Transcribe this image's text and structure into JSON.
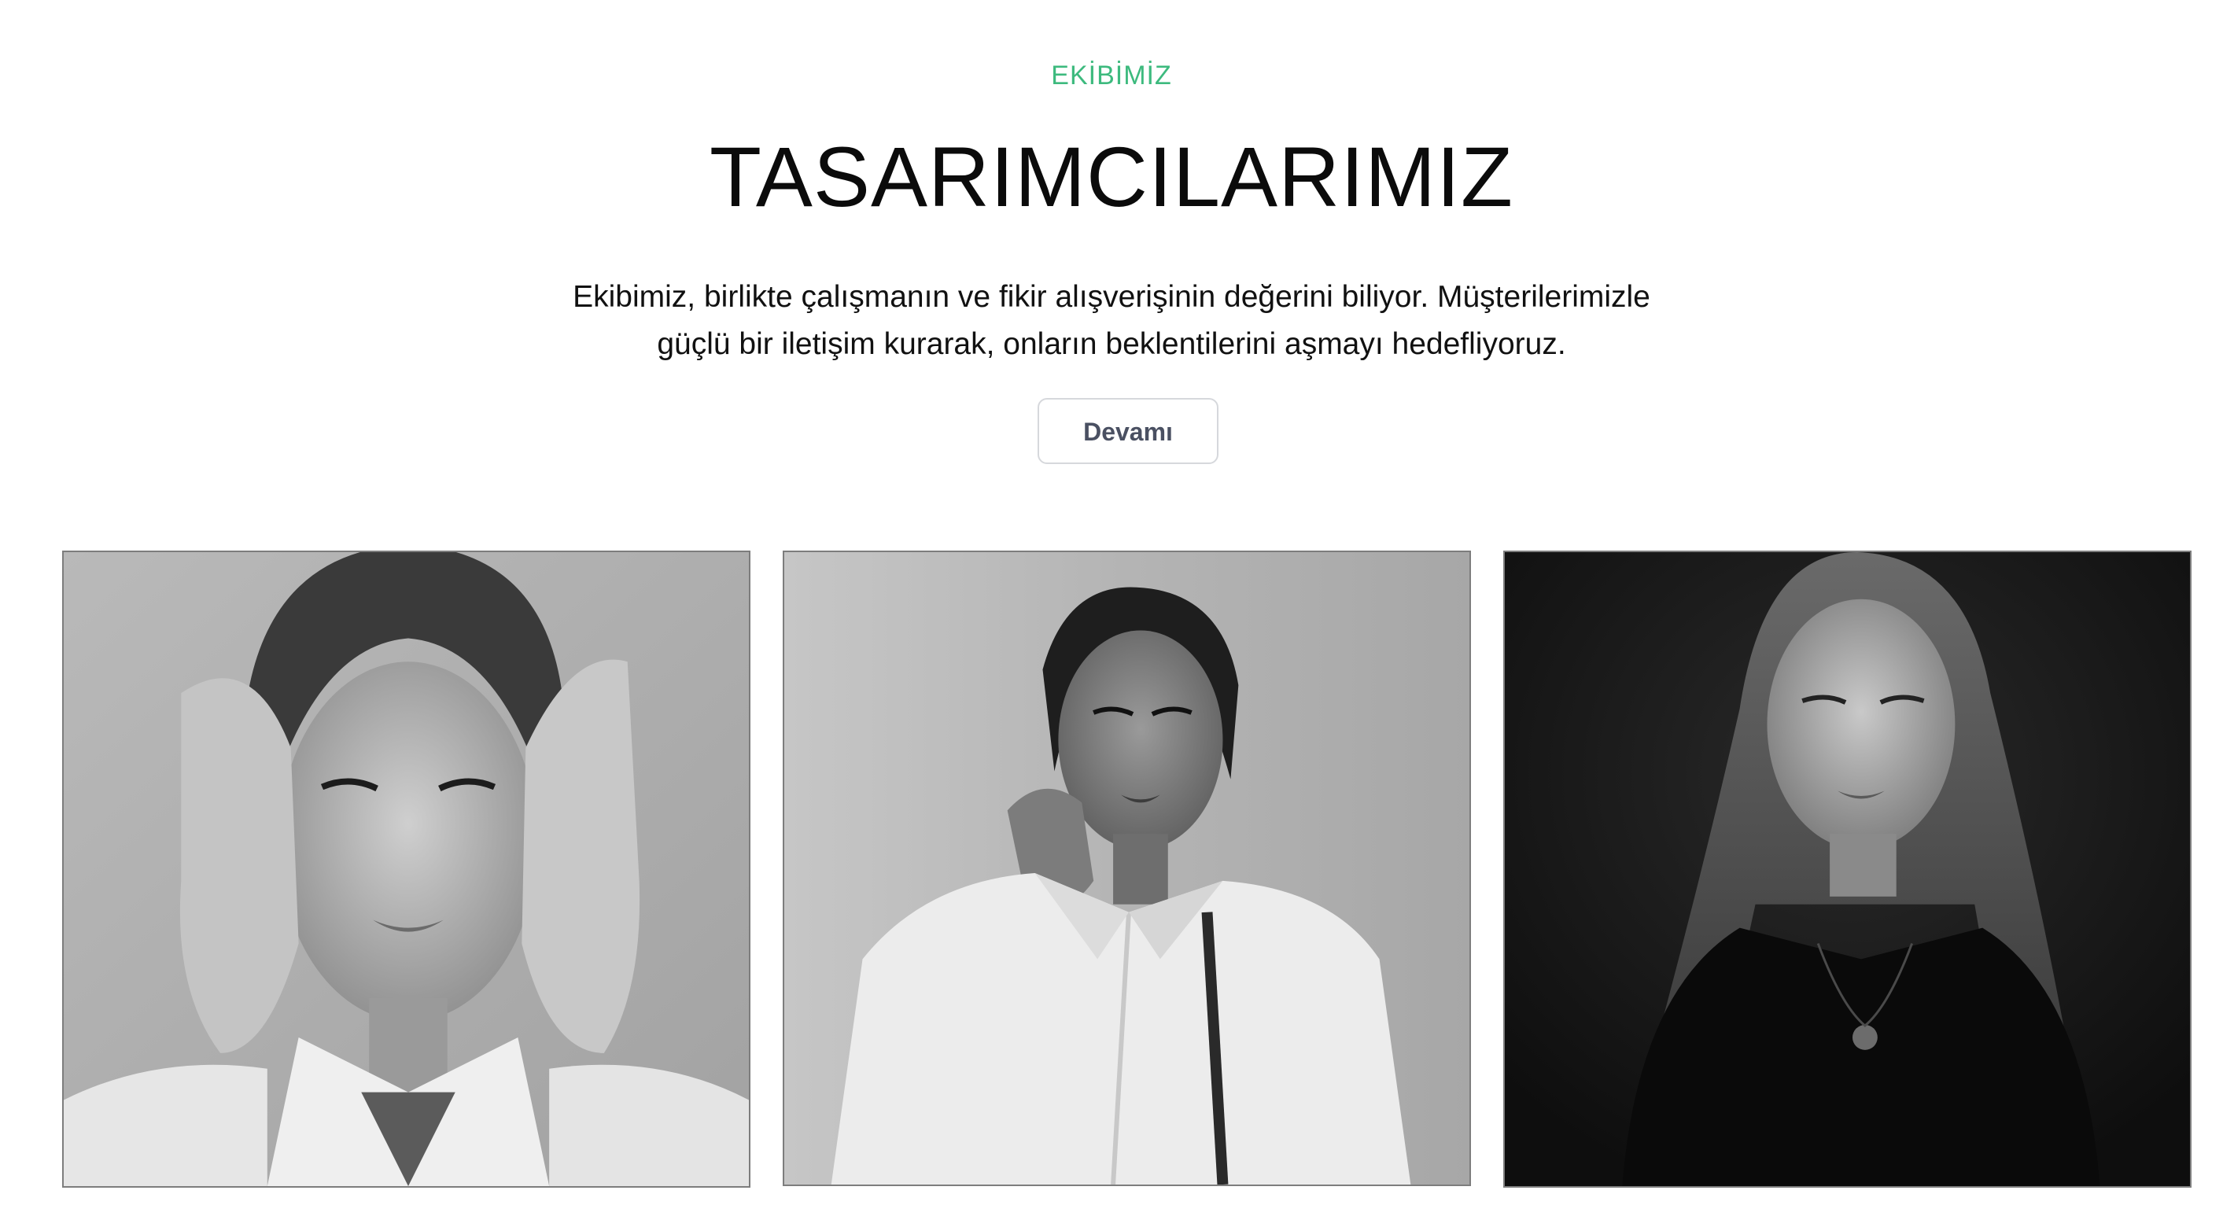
{
  "section": {
    "eyebrow": "EKİBİMİZ",
    "title": "TASARIMCILARIMIZ",
    "description_line1": "Ekibimiz, birlikte çalışmanın ve fikir alışverişinin değerini biliyor. Müşterilerimizle",
    "description_line2": "güçlü bir iletişim kurarak, onların beklentilerini aşmayı hedefliyoruz.",
    "more_button_label": "Devamı"
  },
  "colors": {
    "accent": "#3dba7e",
    "title": "#0b0b0b",
    "button_text": "#4a5062",
    "button_border": "#d6d8dc"
  },
  "team": [
    {
      "photo": "designer-photo-1",
      "style": "grayscale"
    },
    {
      "photo": "designer-photo-2",
      "style": "grayscale"
    },
    {
      "photo": "designer-photo-3",
      "style": "grayscale"
    }
  ]
}
